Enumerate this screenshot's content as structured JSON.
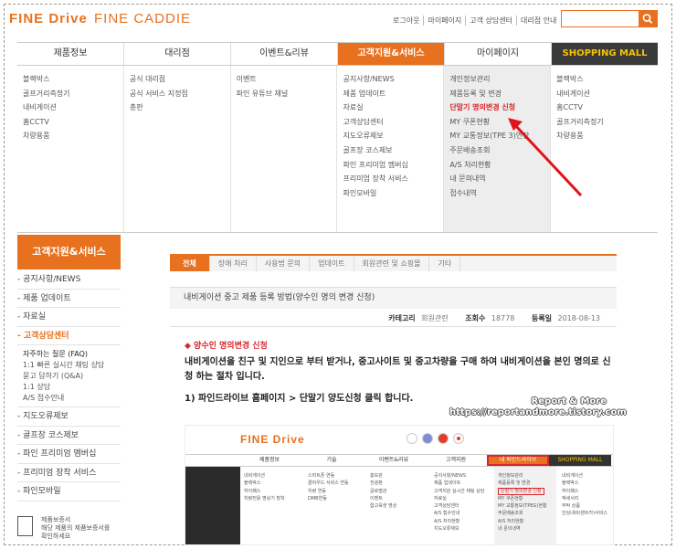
{
  "header": {
    "logo_finedrive": "FINE Drive",
    "logo_finecaddie": "FINE CADDIE",
    "links": [
      "로그아웃",
      "마이페이지",
      "고객 상담센터",
      "대리점 안내"
    ],
    "search": {
      "placeholder": ""
    }
  },
  "nav": {
    "tabs": [
      "제품정보",
      "대리점",
      "이벤트&리뷰",
      "고객지원&서비스",
      "마이페이지",
      "SHOPPING MALL"
    ]
  },
  "mega": {
    "columns": [
      [
        "블랙박스",
        "골프거리측정기",
        "내비게이션",
        "홈CCTV",
        "차량용품"
      ],
      [
        "공식 대리점",
        "공식 서비스 지정점",
        "총판"
      ],
      [
        "이벤트",
        "파인 유튜브 채널"
      ],
      [
        "공지사항/NEWS",
        "제품 업데이트",
        "자료실",
        "고객상담센터",
        "지도오류제보",
        "골프장 코스제보",
        "파인 프리미엄 멤버십",
        "프리미엄 장착 서비스",
        "파인모바일"
      ],
      [
        "개인정보관리",
        "제품등록 및 변경",
        "단말기 명의변경 신청",
        "MY 쿠폰현황",
        "MY 교통정보(TPE 3)연장",
        "주문배송조회",
        "A/S 처리현황",
        "내 문의내역",
        "접수내역"
      ],
      [
        "블랙박스",
        "내비게이션",
        "홈CCTV",
        "골프거리측정기",
        "차량용품"
      ]
    ]
  },
  "sidebar": {
    "title": "고객지원&서비스",
    "items": [
      "- 공지사항/NEWS",
      "- 제품 업데이트",
      "- 자료실",
      "- 고객상담센터"
    ],
    "sub": [
      "자주하는 질문 (FAQ)",
      "1:1 빠른 실시간 채팅 상담",
      "묻고 답하기 (Q&A)",
      "1:1 상담",
      "A/S 접수안내"
    ],
    "items2": [
      "- 지도오류제보",
      "- 골프장 코스제보",
      "- 파인 프리미엄 멤버십",
      "- 프리미엄 장착 서비스",
      "- 파인모바일"
    ],
    "reg": [
      "제품보증서",
      "해당 제품의 제품보증서를",
      "확인하세요"
    ]
  },
  "content": {
    "tabs": [
      "전체",
      "장애 처리",
      "사용법 문의",
      "업데이트",
      "회원관련 및 쇼핑몰",
      "기타"
    ],
    "post_title": "내비게이션 중고 제품 등록 방법(양수인 명의 변경 신청)",
    "meta": {
      "category_label": "카테고리",
      "category": "회원관련",
      "views_label": "조회수",
      "views": "18778",
      "date_label": "등록일",
      "date": "2018-08-13"
    },
    "heading": "◆ 양수인 명의변경 신청",
    "paragraph": "내비게이션을 친구 및 지인으로 부터 받거나, 중고사이트 및 중고차량을 구매 하여 내비게이션을 본인 명의로 신청 하는 절차 입니다.",
    "step1": "1) 파인드라이브 홈페이지 > 단말기 양도신청 클릭 합니다.",
    "watermark": [
      "Report & More",
      "https://reportandmore.tistory.com"
    ]
  },
  "embedded": {
    "logo": "FINE Drive",
    "nav": [
      "제품정보",
      "기술",
      "이벤트&리뷰",
      "고객지원",
      "내 파인드라이브",
      "SHOPPING MALL"
    ],
    "col1": [
      "내비게이션",
      "블랙박스",
      "하이패스",
      "차량전용 명상기 장착"
    ],
    "col2": [
      "스마트폰 연동",
      "클라우드 서비스 연동",
      "차량 연동",
      "DMB연동"
    ],
    "col3": [
      "홍보관",
      "전광판",
      "글로벌관",
      "이벤트",
      "합고육생 명상"
    ],
    "col4": [
      "공지사항/NEWS",
      "제품 업데이트",
      "고객지원 실시간 채팅 상담",
      "자료실",
      "고객상담센터",
      "A/S 접수안내",
      "A/S 처리현황",
      "지도오류제보"
    ],
    "col5": [
      "개인정보관리",
      "제품등록 및 변경",
      "단말기 명의변경 신청",
      "MY 쿠폰현황",
      "MY 교통정보(TPEG)현황",
      "주문배송조회",
      "A/S 처리현황",
      "내 문의내역"
    ],
    "col6": [
      "내비게이션",
      "블랙박스",
      "하이패스",
      "액세서리",
      "부탁 상품",
      "안심내비(렌트카)서비스"
    ]
  },
  "colors": {
    "accent": "#e8711f",
    "highlight": "#d9262b",
    "mall_bg": "#3a3a3a",
    "mall_text": "#f5c400"
  }
}
